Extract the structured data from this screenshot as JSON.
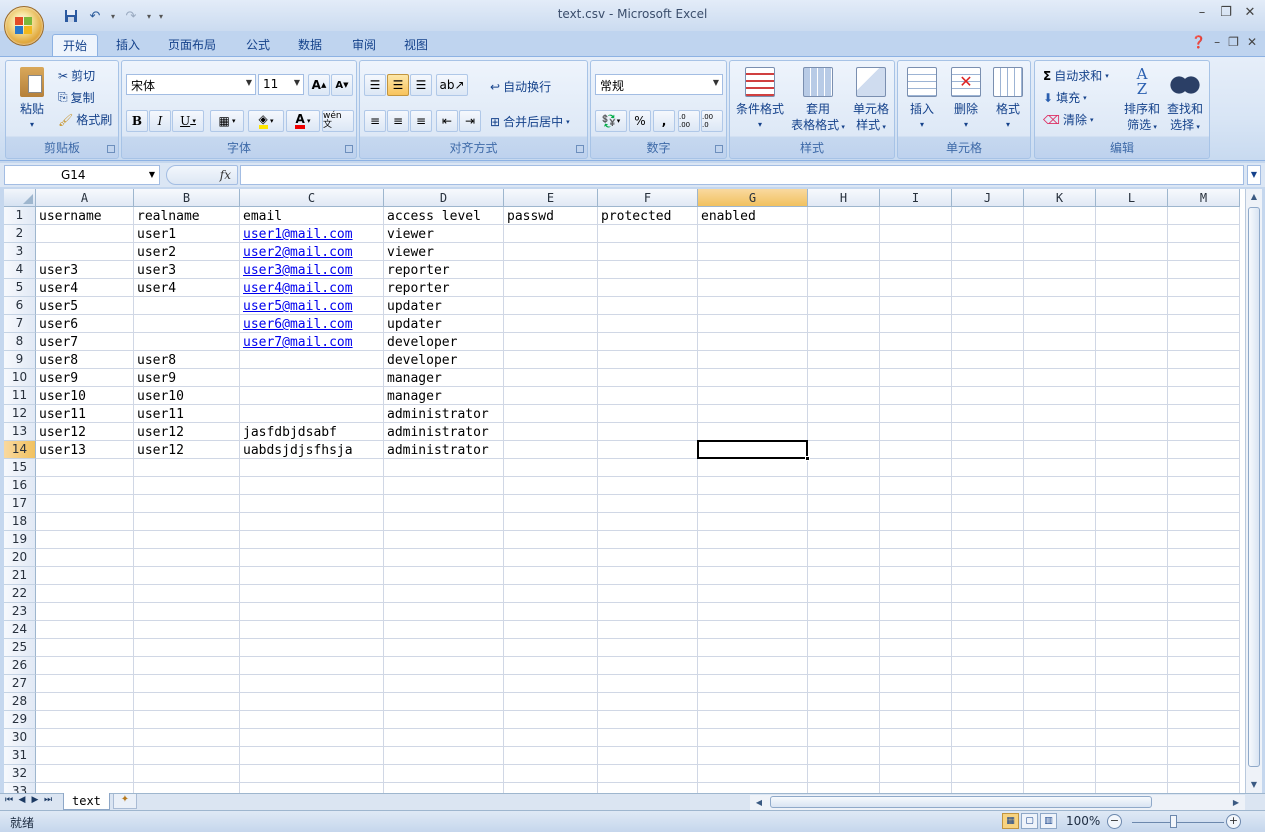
{
  "window": {
    "title": "text.csv - Microsoft Excel"
  },
  "qat": {
    "icons": [
      "save-icon",
      "undo-icon",
      "redo-icon",
      "customize-icon"
    ]
  },
  "tabs": [
    "开始",
    "插入",
    "页面布局",
    "公式",
    "数据",
    "审阅",
    "视图"
  ],
  "active_tab": "开始",
  "ribbon": {
    "clipboard": {
      "label": "剪贴板",
      "paste": "粘贴",
      "cut": "剪切",
      "copy": "复制",
      "format_painter": "格式刷"
    },
    "font": {
      "label": "字体",
      "font_name": "宋体",
      "font_size": "11",
      "bold": "B",
      "italic": "I",
      "underline": "U",
      "grow": "A",
      "shrink": "A",
      "phonetic": "wén 文"
    },
    "alignment": {
      "label": "对齐方式",
      "wrap": "自动换行",
      "merge": "合并后居中"
    },
    "number": {
      "label": "数字",
      "format": "常规",
      "percent": "%",
      "comma": ",",
      "inc_decimal": ".0 .00",
      "dec_decimal": ".00 .0"
    },
    "styles": {
      "label": "样式",
      "conditional": "条件格式",
      "table_format": [
        "套用",
        "表格格式"
      ],
      "cell_styles": [
        "单元格",
        "样式"
      ]
    },
    "cells": {
      "label": "单元格",
      "insert": "插入",
      "delete": "删除",
      "format": "格式"
    },
    "editing": {
      "label": "编辑",
      "autosum": "自动求和",
      "fill": "填充",
      "clear": "清除",
      "sort": [
        "排序和",
        "筛选"
      ],
      "find": [
        "查找和",
        "选择"
      ]
    }
  },
  "formula_bar": {
    "name_box": "G14",
    "fx": "fx",
    "value": ""
  },
  "columns": [
    "A",
    "B",
    "C",
    "D",
    "E",
    "F",
    "G",
    "H",
    "I",
    "J",
    "K",
    "L",
    "M"
  ],
  "selected_column": "G",
  "selected_row": 14,
  "rows_visible": 33,
  "cells": [
    [
      "username",
      "realname",
      "email",
      "access level",
      "passwd",
      "protected",
      "enabled"
    ],
    [
      "",
      "user1",
      "user1@mail.com",
      "viewer",
      "",
      "",
      ""
    ],
    [
      "",
      "user2",
      "user2@mail.com",
      "viewer",
      "",
      "",
      ""
    ],
    [
      "user3",
      "user3",
      "user3@mail.com",
      "reporter",
      "",
      "",
      ""
    ],
    [
      "user4",
      "user4",
      "user4@mail.com",
      "reporter",
      "",
      "",
      ""
    ],
    [
      "user5",
      "",
      "user5@mail.com",
      "updater",
      "",
      "",
      ""
    ],
    [
      "user6",
      "",
      "user6@mail.com",
      "updater",
      "",
      "",
      ""
    ],
    [
      "user7",
      "",
      "user7@mail.com",
      "developer",
      "",
      "",
      ""
    ],
    [
      "user8",
      "user8",
      "",
      "developer",
      "",
      "",
      ""
    ],
    [
      "user9",
      "user9",
      "",
      "manager",
      "",
      "",
      ""
    ],
    [
      "user10",
      "user10",
      "",
      "manager",
      "",
      "",
      ""
    ],
    [
      "user11",
      "user11",
      "",
      "administrator",
      "",
      "",
      ""
    ],
    [
      "user12",
      "user12",
      "jasfdbjdsabf",
      "administrator",
      "",
      "",
      ""
    ],
    [
      "user13",
      "user12",
      "uabdsjdjsfhsja",
      "administrator",
      "",
      "",
      ""
    ]
  ],
  "sheet_tab": "text",
  "status": {
    "ready": "就绪",
    "zoom": "100%"
  },
  "colors": {
    "accent": "#15428b",
    "selection_header": "#f1c15f",
    "link": "#0000ee"
  }
}
